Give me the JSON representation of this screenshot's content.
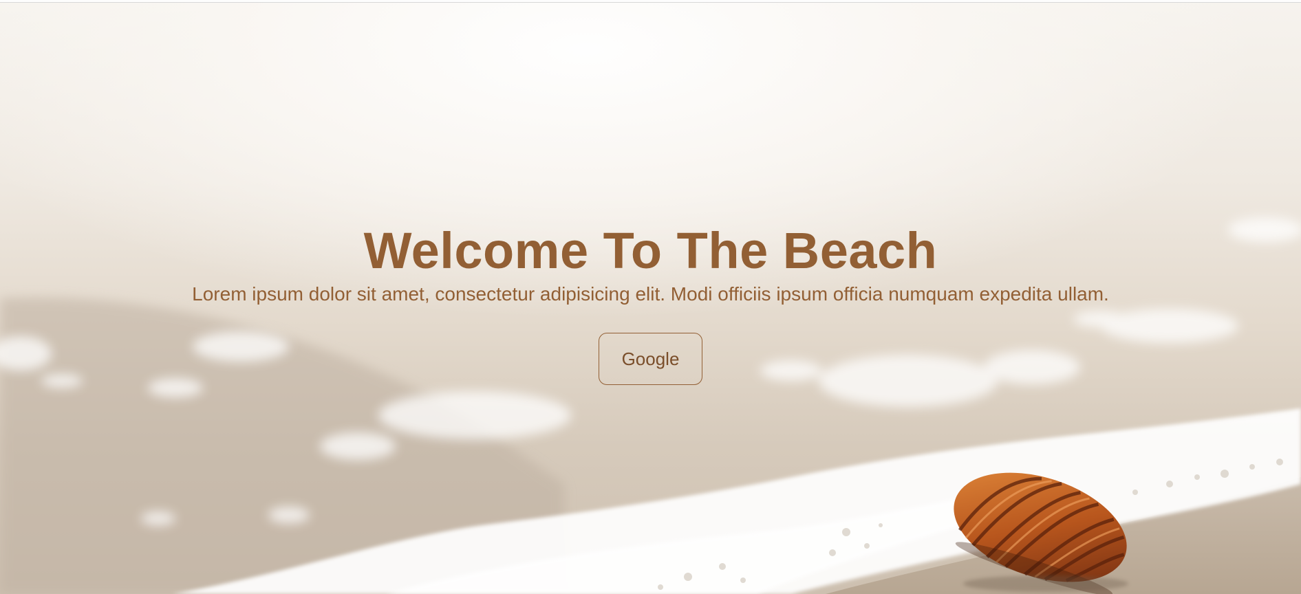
{
  "hero": {
    "title": "Welcome To The Beach",
    "subtitle": "Lorem ipsum dolor sit amet, consectetur adipisicing elit. Modi officiis ipsum officia numquam expedita ullam.",
    "button_label": "Google"
  },
  "colors": {
    "accent": "#925f34",
    "background": "#efe9e1",
    "foam": "#ffffff",
    "shell": "#c0641f"
  },
  "icons": {
    "background_image": "beach-shell-background"
  }
}
